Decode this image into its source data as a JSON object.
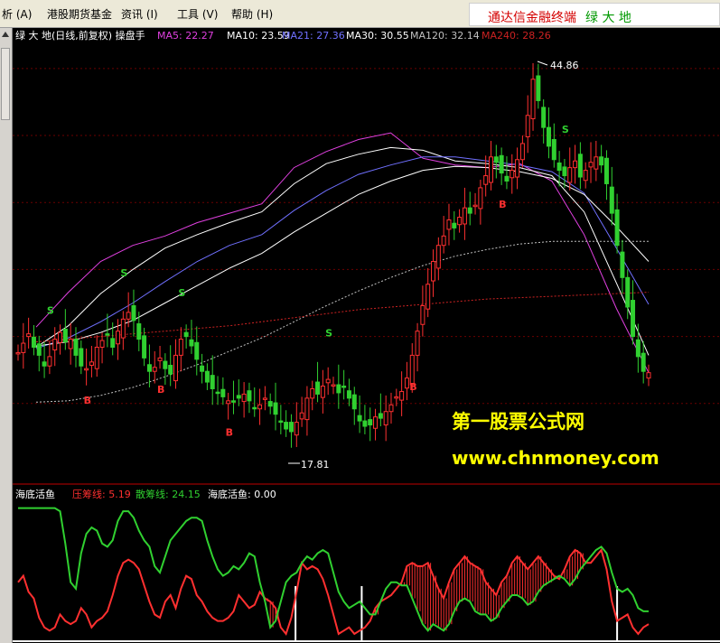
{
  "menubar": {
    "items": [
      "析 (A)",
      "港股期货基金",
      "资讯 (I)",
      "工具 (V)",
      "帮助 (H)"
    ],
    "brand": {
      "part1": "通达信金融终端",
      "part2": "绿 大 地"
    }
  },
  "main_header": {
    "title": "绿 大 地(日线,前复权) 操盘手",
    "ma": [
      {
        "label": "MA5: 22.27",
        "color": "#E040E0"
      },
      {
        "label": "MA10: 23.59",
        "color": "#FFFFFF"
      },
      {
        "label": "MA21: 27.36",
        "color": "#7070FF"
      },
      {
        "label": "MA30: 30.55",
        "color": "#FFFFFF"
      },
      {
        "label": "MA120: 32.14",
        "color": "#C0C0C0"
      },
      {
        "label": "MA240: 28.26",
        "color": "#CC2222"
      }
    ]
  },
  "sub_header": {
    "title": "海底活鱼",
    "items": [
      {
        "label": "压筹线: 5.19",
        "color": "#FF3030"
      },
      {
        "label": "散筹线: 24.15",
        "color": "#30D030"
      },
      {
        "label": "海底活鱼: 0.00",
        "color": "#FFFFFF"
      }
    ]
  },
  "watermark": {
    "line1": "第一股票公式网",
    "line2": "www.chnmoney.com"
  },
  "chart_data": [
    {
      "type": "candlestick",
      "title": "绿 大 地(日线,前复权) 操盘手",
      "annotations": [
        {
          "text": "44.86",
          "kind": "high"
        },
        {
          "text": "17.81",
          "kind": "low"
        }
      ],
      "signals": {
        "buy": "B",
        "sell": "S"
      },
      "price_series": [
        23.8,
        24.5,
        25.2,
        24.2,
        23.6,
        22.8,
        23.5,
        24.8,
        25.3,
        24.6,
        24.8,
        23.6,
        22.8,
        22.6,
        23.1,
        24.2,
        24.7,
        25.1,
        24.2,
        25.4,
        26.3,
        26.8,
        26.2,
        24.8,
        23.4,
        22.4,
        22.7,
        23.4,
        22.6,
        22.2,
        23.6,
        24.8,
        25.0,
        24.3,
        23.3,
        22.4,
        21.6,
        21.1,
        20.8,
        20.5,
        20.2,
        20.1,
        20.4,
        20.7,
        20.2,
        19.6,
        19.9,
        20.4,
        19.8,
        19.2,
        18.6,
        18.1,
        17.9,
        18.6,
        19.3,
        20.4,
        21.1,
        20.7,
        21.3,
        21.8,
        21.4,
        20.8,
        21.2,
        20.4,
        19.6,
        18.7,
        18.3,
        18.4,
        19.0,
        18.9,
        19.4,
        19.9,
        20.5,
        20.9,
        21.9,
        23.6,
        25.4,
        27.3,
        28.9,
        30.6,
        31.8,
        32.5,
        33.7,
        33.1,
        33.9,
        34.6,
        34.2,
        34.8,
        36.1,
        37.0,
        38.4,
        38.0,
        37.2,
        36.6,
        37.4,
        38.2,
        39.4,
        41.5,
        44.2,
        42.6,
        40.6,
        39.2,
        38.2,
        37.4,
        37.0,
        37.6,
        38.1,
        36.9,
        37.4,
        38.0,
        38.4,
        37.8,
        36.4,
        34.2,
        31.8,
        29.4,
        27.2,
        25.0,
        23.5,
        22.4,
        22.3
      ],
      "ma": [
        {
          "name": "MA5",
          "color": "#E040E0",
          "values": [
            25.7,
            28.3,
            30.6,
            31.8,
            32.5,
            33.5,
            34.2,
            34.9,
            37.6,
            38.8,
            39.7,
            40.2,
            38.3,
            37.8,
            37.6,
            37.9,
            36.6,
            32.6,
            27.1,
            22.3
          ]
        },
        {
          "name": "MA10",
          "color": "#FFFFFF",
          "values": [
            24.2,
            25.8,
            28.2,
            30.0,
            31.6,
            32.6,
            33.5,
            34.3,
            36.4,
            37.9,
            38.6,
            39.1,
            38.9,
            38.1,
            37.9,
            37.6,
            37.0,
            34.3,
            29.0,
            23.6
          ]
        },
        {
          "name": "MA21",
          "color": "#7070FF",
          "values": [
            24.1,
            24.9,
            26.1,
            27.5,
            29.1,
            30.6,
            31.8,
            32.6,
            34.4,
            35.9,
            37.1,
            37.8,
            38.4,
            38.4,
            38.1,
            37.8,
            37.3,
            35.7,
            31.6,
            27.4
          ]
        },
        {
          "name": "MA30",
          "color": "#FFFFFF",
          "values": [
            24.3,
            24.6,
            25.3,
            26.2,
            27.5,
            28.8,
            30.1,
            31.2,
            32.8,
            34.2,
            35.6,
            36.6,
            37.4,
            37.7,
            37.6,
            37.3,
            36.8,
            35.6,
            33.2,
            30.6
          ]
        },
        {
          "name": "MA120",
          "color": "#C0C0C0",
          "values": [
            20.1,
            20.2,
            20.6,
            21.2,
            22.0,
            22.9,
            23.9,
            24.9,
            26.1,
            27.3,
            28.4,
            29.4,
            30.3,
            31.0,
            31.5,
            31.9,
            32.1,
            32.1,
            32.1,
            32.1
          ]
        },
        {
          "name": "MA240",
          "color": "#CC2222",
          "values": [
            24.6,
            24.8,
            25.0,
            25.2,
            25.4,
            25.6,
            25.8,
            26.1,
            26.4,
            26.7,
            27.0,
            27.2,
            27.4,
            27.6,
            27.8,
            27.9,
            28.0,
            28.1,
            28.2,
            28.3
          ]
        }
      ]
    },
    {
      "type": "line",
      "title": "海底活鱼",
      "series": [
        {
          "name": "压筹线",
          "color": "#FF3030",
          "values": [
            18,
            20,
            15,
            13,
            7,
            4,
            3,
            4,
            8,
            6,
            5,
            6,
            10,
            8,
            4,
            6,
            7,
            9,
            14,
            20,
            24,
            25,
            24,
            22,
            17,
            12,
            8,
            7,
            12,
            14,
            10,
            16,
            20,
            19,
            14,
            12,
            9,
            7,
            6,
            6,
            7,
            9,
            14,
            12,
            10,
            11,
            15,
            13,
            12,
            10,
            4,
            2,
            7,
            15,
            24,
            22,
            23,
            22,
            19,
            14,
            8,
            2,
            3,
            4,
            2,
            3,
            4,
            6,
            10,
            12,
            13,
            14,
            16,
            18,
            23,
            24,
            23,
            23,
            24,
            20,
            16,
            13,
            18,
            22,
            24,
            26,
            24,
            23,
            22,
            18,
            16,
            14,
            18,
            20,
            24,
            26,
            24,
            22,
            24,
            26,
            24,
            22,
            20,
            19,
            22,
            26,
            28,
            27,
            24,
            24,
            26,
            28,
            22,
            12,
            6,
            7,
            8,
            4,
            2,
            4,
            5
          ]
        },
        {
          "name": "散筹线",
          "color": "#30D030",
          "values": [
            41,
            41,
            41,
            41,
            41,
            41,
            41,
            41,
            40,
            30,
            18,
            16,
            27,
            33,
            35,
            34,
            30,
            29,
            31,
            37,
            40,
            40,
            38,
            34,
            31,
            29,
            23,
            21,
            26,
            31,
            33,
            35,
            37,
            38,
            38,
            37,
            31,
            26,
            22,
            20,
            21,
            23,
            22,
            24,
            27,
            26,
            18,
            12,
            4,
            6,
            12,
            18,
            20,
            21,
            24,
            26,
            25,
            27,
            28,
            27,
            21,
            15,
            12,
            10,
            11,
            12,
            10,
            8,
            8,
            12,
            16,
            18,
            18,
            17,
            17,
            13,
            9,
            5,
            3,
            5,
            4,
            3,
            5,
            9,
            12,
            13,
            12,
            9,
            8,
            8,
            6,
            7,
            10,
            12,
            14,
            14,
            13,
            11,
            12,
            15,
            17,
            18,
            19,
            20,
            19,
            17,
            19,
            22,
            24,
            26,
            28,
            29,
            27,
            21,
            16,
            15,
            16,
            14,
            10,
            9,
            9
          ]
        },
        {
          "name": "海底活鱼",
          "color": "#FFFFFF",
          "values": [
            0
          ]
        }
      ],
      "ylim": [
        0,
        42
      ]
    }
  ]
}
